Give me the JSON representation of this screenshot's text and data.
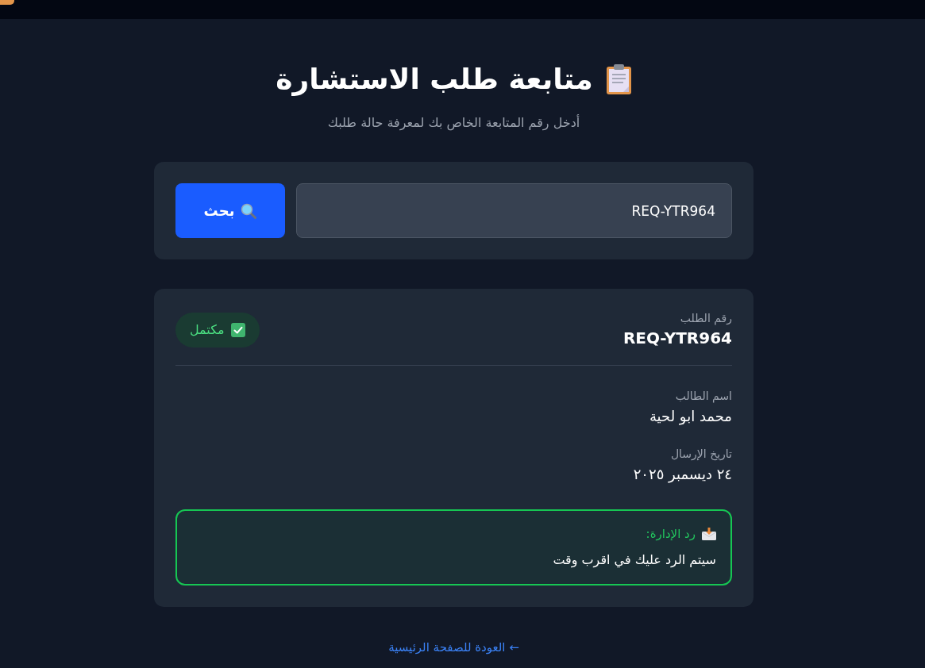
{
  "header": {
    "title": "متابعة طلب الاستشارة",
    "subtitle": "أدخل رقم المتابعة الخاص بك لمعرفة حالة طلبك"
  },
  "search": {
    "value": "REQ-YTR964",
    "button_label": "بحث"
  },
  "result": {
    "request_number_label": "رقم الطلب",
    "request_number": "REQ-YTR964",
    "status": {
      "kind": "completed",
      "label": "مكتمل"
    },
    "fields": [
      {
        "label": "اسم الطالب",
        "value": "محمد ابو لحية"
      },
      {
        "label": "تاريخ الإرسال",
        "value": "٢٤ ديسمبر ٢٠٢٥"
      }
    ],
    "admin_reply": {
      "title": "رد الإدارة:",
      "text": "سيتم الرد عليك في اقرب وقت"
    }
  },
  "back_link": "← العودة للصفحة الرئيسية"
}
